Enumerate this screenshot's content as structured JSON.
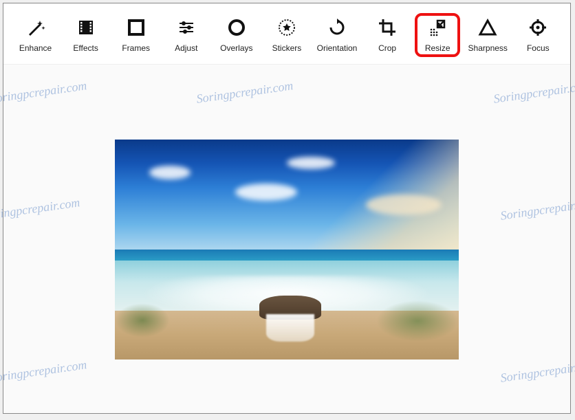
{
  "toolbar": {
    "items": [
      {
        "id": "enhance",
        "label": "Enhance",
        "icon": "wand"
      },
      {
        "id": "effects",
        "label": "Effects",
        "icon": "film"
      },
      {
        "id": "frames",
        "label": "Frames",
        "icon": "square"
      },
      {
        "id": "adjust",
        "label": "Adjust",
        "icon": "sliders"
      },
      {
        "id": "overlays",
        "label": "Overlays",
        "icon": "circle"
      },
      {
        "id": "stickers",
        "label": "Stickers",
        "icon": "star-circle"
      },
      {
        "id": "orientation",
        "label": "Orientation",
        "icon": "rotate"
      },
      {
        "id": "crop",
        "label": "Crop",
        "icon": "crop"
      },
      {
        "id": "resize",
        "label": "Resize",
        "icon": "resize",
        "highlighted": true
      },
      {
        "id": "sharpness",
        "label": "Sharpness",
        "icon": "triangle"
      },
      {
        "id": "focus",
        "label": "Focus",
        "icon": "target"
      }
    ]
  },
  "watermark_text": "Soringpcrepair.com"
}
